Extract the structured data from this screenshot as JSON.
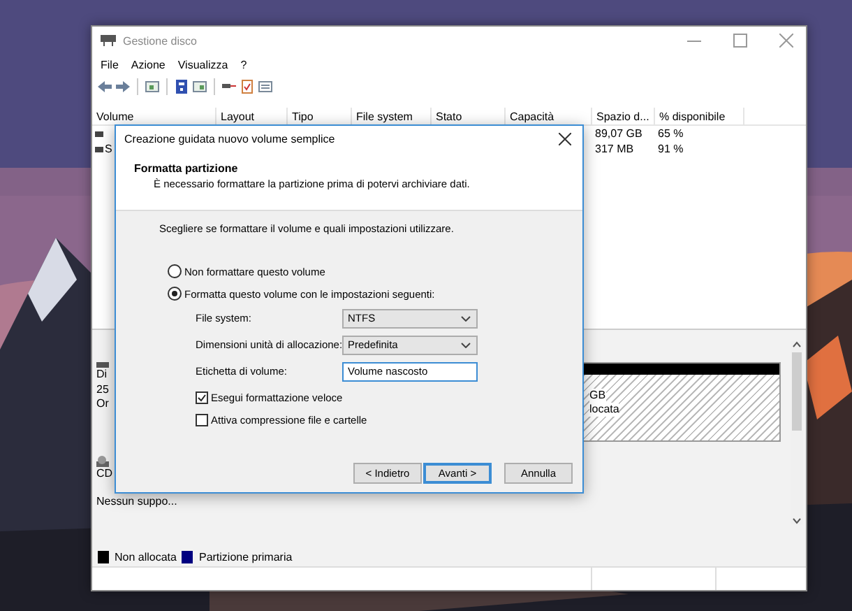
{
  "window": {
    "title": "Gestione disco"
  },
  "menu": [
    "File",
    "Azione",
    "Visualizza",
    "?"
  ],
  "volume_table": {
    "columns": [
      "Volume",
      "Layout",
      "Tipo",
      "File system",
      "Stato",
      "Capacità",
      "Spazio d...",
      "% disponibile"
    ],
    "rows": [
      {
        "volume": "",
        "spazio_disponibile": "89,07 GB",
        "percentuale_disponibile": "65 %"
      },
      {
        "volume": "S",
        "spazio_disponibile": "317 MB",
        "percentuale_disponibile": "91 %"
      }
    ]
  },
  "disks": [
    {
      "kind": "disk",
      "label_lines": [
        "Di",
        "25",
        "Or"
      ],
      "partition_lines": [
        "GB",
        "locata"
      ]
    },
    {
      "kind": "cdrom",
      "label_lines": [
        "CD",
        "Nessun suppo..."
      ]
    }
  ],
  "legend": [
    {
      "label": "Non allocata",
      "color": "#000000"
    },
    {
      "label": "Partizione primaria",
      "color": "#000080"
    }
  ],
  "dialog": {
    "title": "Creazione guidata nuovo volume semplice",
    "heading": "Formatta partizione",
    "subtitle": "È necessario formattare la partizione prima di potervi archiviare dati.",
    "prompt": "Scegliere se formattare il volume e quali impostazioni utilizzare.",
    "options": [
      {
        "label": "Non formattare questo volume",
        "selected": false
      },
      {
        "label": "Formatta questo volume con le impostazioni seguenti:",
        "selected": true
      }
    ],
    "fields": [
      {
        "kind": "select",
        "label": "File system:",
        "value": "NTFS"
      },
      {
        "kind": "select",
        "label": "Dimensioni unità di allocazione:",
        "value": "Predefinita"
      },
      {
        "kind": "text",
        "label": "Etichetta di volume:",
        "value": "Volume nascosto"
      }
    ],
    "checkboxes": [
      {
        "label": "Esegui formattazione veloce",
        "checked": true
      },
      {
        "label": "Attiva compressione file e cartelle",
        "checked": false
      }
    ],
    "buttons": [
      {
        "label": "< Indietro",
        "default": false
      },
      {
        "label": "Avanti >",
        "default": true
      },
      {
        "label": "Annulla",
        "default": false
      }
    ]
  }
}
